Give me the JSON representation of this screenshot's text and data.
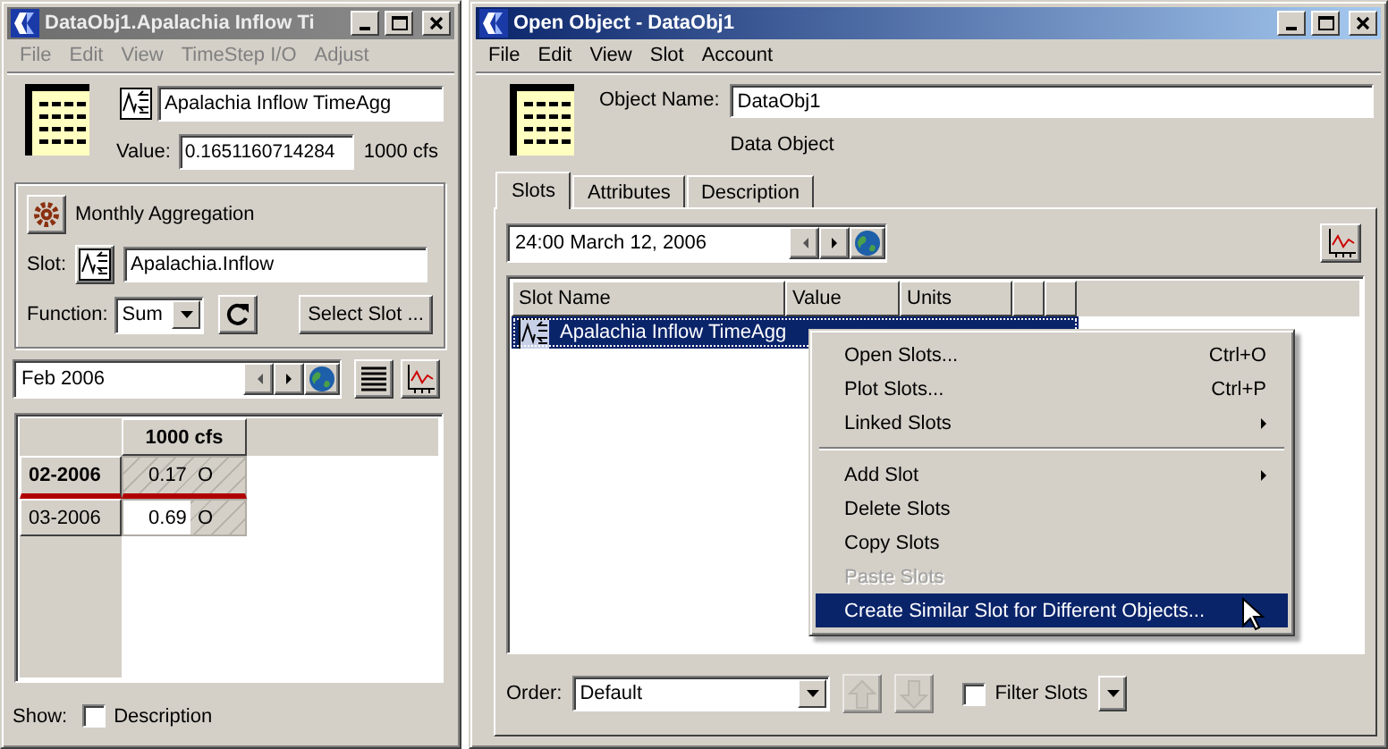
{
  "slot_window": {
    "title": "DataObj1.Apalachia Inflow Ti",
    "active": false,
    "menu": [
      {
        "label": "File",
        "disabled": true
      },
      {
        "label": "Edit",
        "disabled": true
      },
      {
        "label": "View",
        "disabled": true
      },
      {
        "label": "TimeStep I/O",
        "disabled": true
      },
      {
        "label": "Adjust",
        "disabled": true
      }
    ],
    "slot_name": "Apalachia Inflow TimeAgg",
    "value_label": "Value:",
    "value": "0.1651160714284",
    "value_units": "1000 cfs",
    "aggregation": {
      "title": "Monthly Aggregation",
      "slot_label": "Slot:",
      "slot": "Apalachia.Inflow",
      "function_label": "Function:",
      "function": "Sum",
      "select_button": "Select Slot ..."
    },
    "date": "Feb 2006",
    "table": {
      "columns": [
        "1000 cfs"
      ],
      "rows": [
        {
          "date": "02-2006",
          "value": "0.17",
          "flag": "O",
          "selected": true
        },
        {
          "date": "03-2006",
          "value": "0.69",
          "flag": "O",
          "selected": false
        }
      ]
    },
    "show_label": "Show:",
    "description_checkbox": {
      "label": "Description",
      "checked": false
    }
  },
  "object_window": {
    "title": "Open Object - DataObj1",
    "active": true,
    "menu": [
      {
        "label": "File",
        "disabled": false
      },
      {
        "label": "Edit",
        "disabled": false
      },
      {
        "label": "View",
        "disabled": false
      },
      {
        "label": "Slot",
        "disabled": false
      },
      {
        "label": "Account",
        "disabled": false
      }
    ],
    "object_name_label": "Object Name:",
    "object_name": "DataObj1",
    "object_type": "Data Object",
    "tabs": [
      {
        "label": "Slots",
        "selected": true
      },
      {
        "label": "Attributes",
        "selected": false
      },
      {
        "label": "Description",
        "selected": false
      }
    ],
    "date": "24:00 March 12, 2006",
    "slot_table": {
      "columns": [
        "Slot Name",
        "Value",
        "Units"
      ],
      "rows": [
        {
          "name": "Apalachia Inflow TimeAgg",
          "selected": true
        }
      ]
    },
    "context_menu": [
      {
        "kind": "item",
        "label": "Open Slots...",
        "shortcut": "Ctrl+O",
        "disabled": false,
        "selected": false
      },
      {
        "kind": "item",
        "label": "Plot Slots...",
        "shortcut": "Ctrl+P",
        "disabled": false,
        "selected": false
      },
      {
        "kind": "submenu",
        "label": "Linked Slots",
        "disabled": false,
        "selected": false
      },
      {
        "kind": "separator"
      },
      {
        "kind": "submenu",
        "label": "Add Slot",
        "disabled": false,
        "selected": false
      },
      {
        "kind": "item",
        "label": "Delete Slots",
        "disabled": false,
        "selected": false
      },
      {
        "kind": "item",
        "label": "Copy Slots",
        "disabled": false,
        "selected": false
      },
      {
        "kind": "item",
        "label": "Paste Slots",
        "disabled": true,
        "selected": false
      },
      {
        "kind": "item",
        "label": "Create Similar Slot for Different Objects...",
        "disabled": false,
        "selected": true
      }
    ],
    "order_label": "Order:",
    "order": "Default",
    "move_buttons": [
      {
        "kind": "up",
        "disabled": true
      },
      {
        "kind": "down",
        "disabled": true
      }
    ],
    "filter_checkbox": {
      "label": "Filter Slots",
      "checked": false
    }
  }
}
